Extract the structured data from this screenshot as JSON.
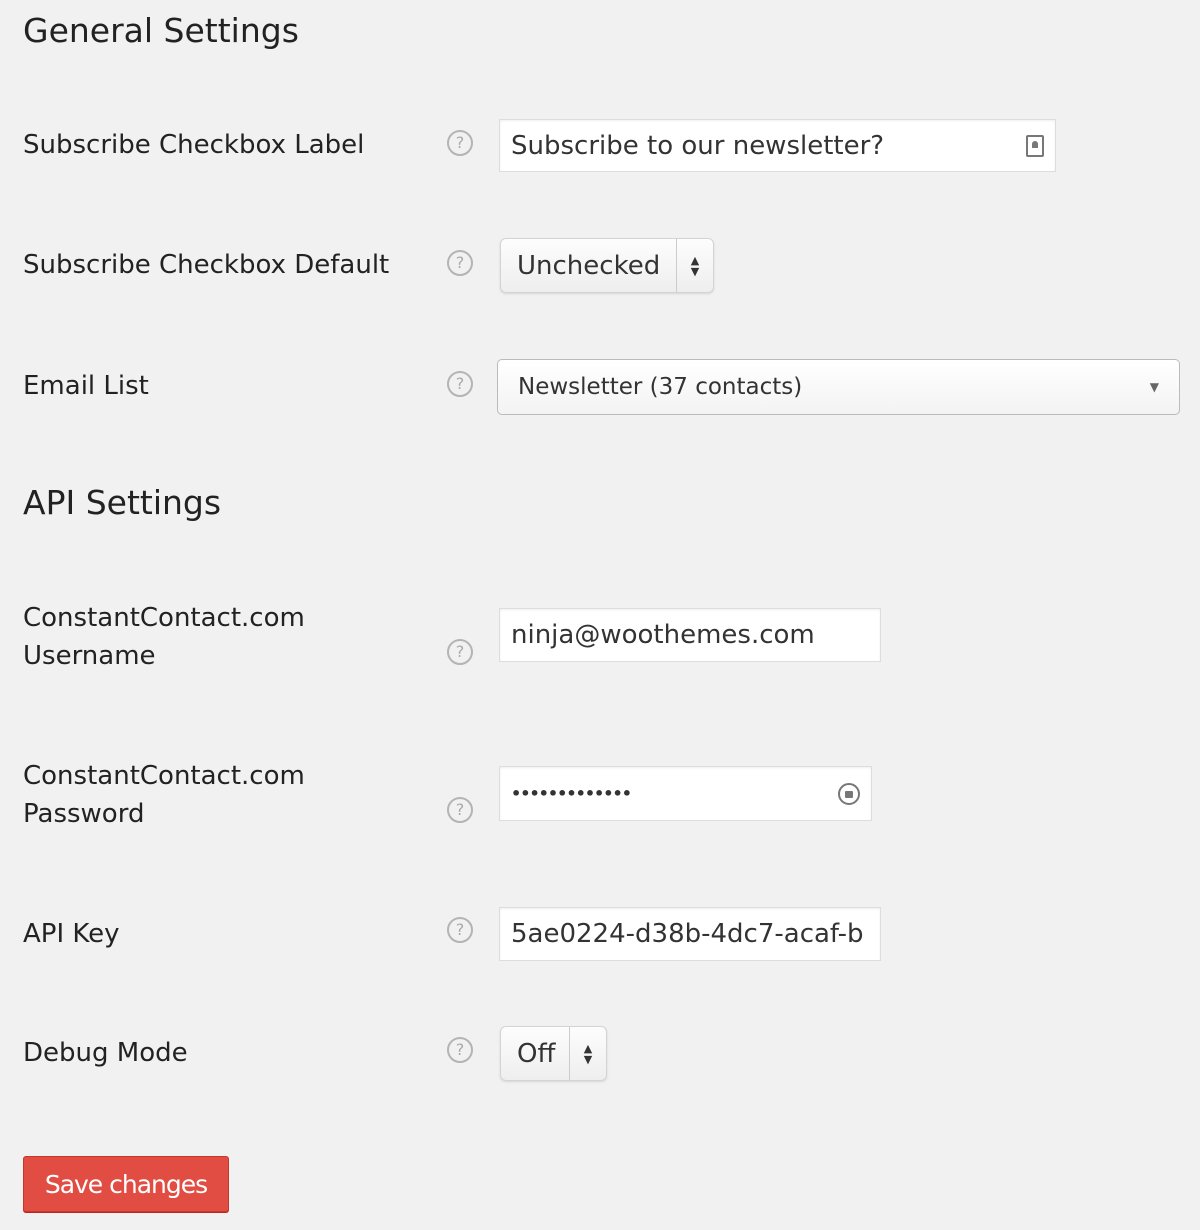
{
  "general": {
    "heading": "General Settings",
    "fields": {
      "checkbox_label": {
        "label": "Subscribe Checkbox Label",
        "value": "Subscribe to our newsletter?"
      },
      "checkbox_default": {
        "label": "Subscribe Checkbox Default",
        "value": "Unchecked"
      },
      "email_list": {
        "label": "Email List",
        "value": "Newsletter (37 contacts)"
      }
    }
  },
  "api": {
    "heading": "API Settings",
    "fields": {
      "username": {
        "label_line1": "ConstantContact.com",
        "label_line2": "Username",
        "value": "ninja@woothemes.com"
      },
      "password": {
        "label_line1": "ConstantContact.com",
        "label_line2": "Password",
        "value": "•••••••••••••"
      },
      "api_key": {
        "label": "API Key",
        "value": "5ae0224-d38b-4dc7-acaf-b"
      },
      "debug": {
        "label": "Debug Mode",
        "value": "Off"
      }
    }
  },
  "help_glyph": "?",
  "save_label": "Save changes",
  "colors": {
    "accent": "#e14d43",
    "background": "#f1f1f1"
  },
  "icons": [
    "help-icon",
    "contact-card-icon",
    "password-key-icon",
    "select-arrows-icon",
    "dropdown-caret-icon"
  ]
}
